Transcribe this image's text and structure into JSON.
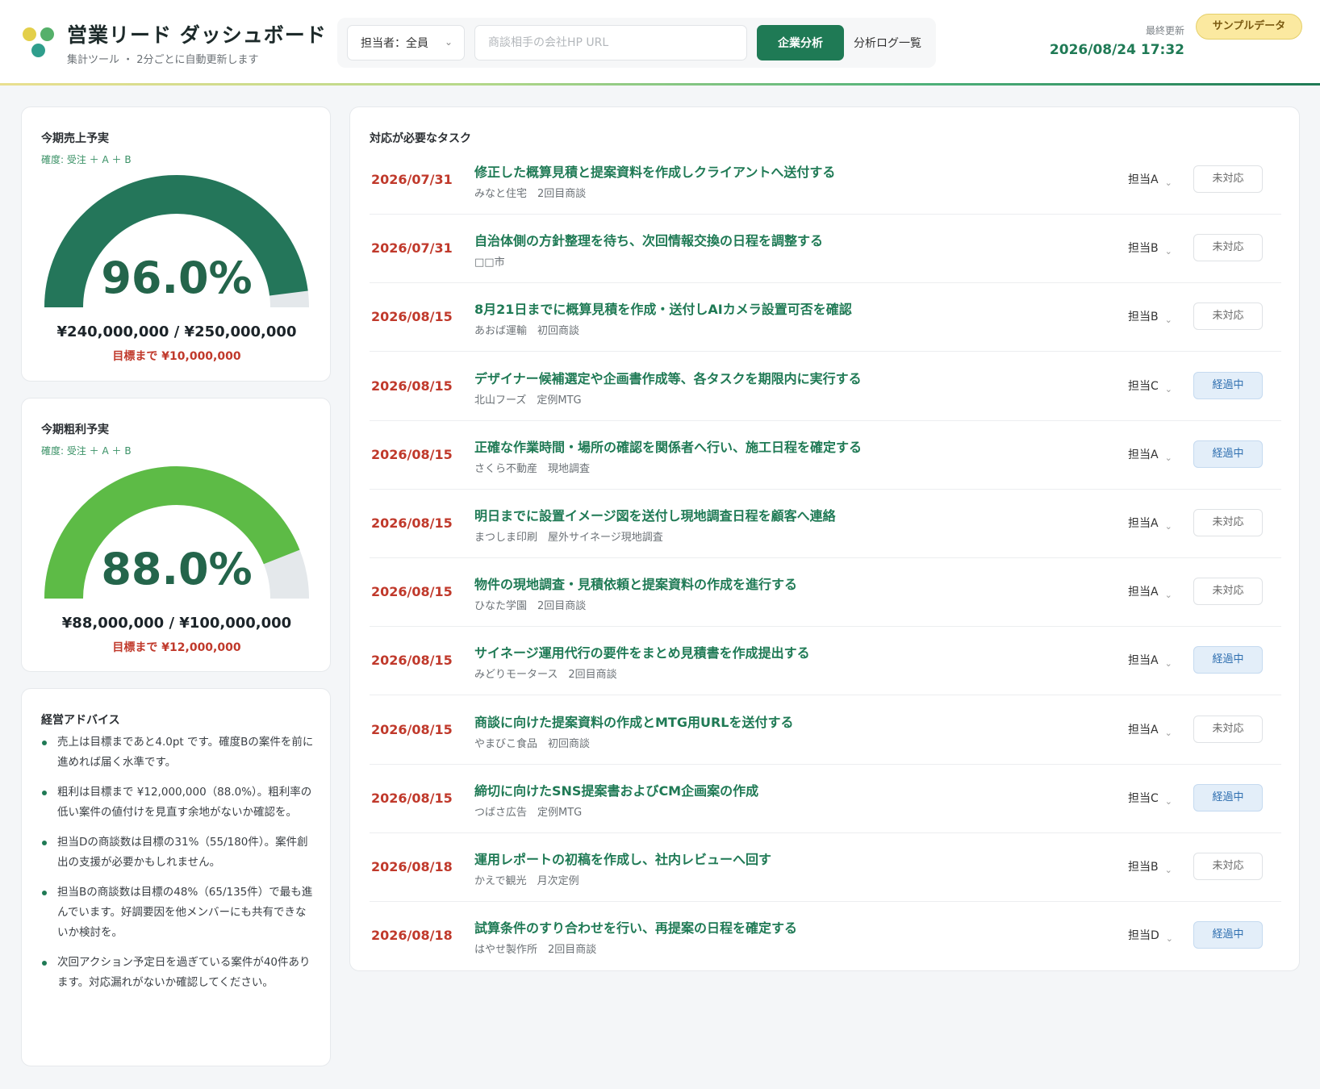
{
  "header": {
    "title": "営業リード ダッシュボード",
    "subtitle": "集計ツール ・ 2分ごとに自動更新します",
    "assignee_select": "担当者：全員",
    "url_placeholder": "商談相手の会社HP URL",
    "analyze_button": "企業分析",
    "log_link": "分析ログ一覧",
    "updated_label": "最終更新",
    "updated_value": "2026/08/24 17:32",
    "sample_badge": "サンプルデータ"
  },
  "colors": {
    "brand_green": "#1f7a55",
    "sales_gauge": "#24765a",
    "profit_gauge": "#5dbb46",
    "gauge_track": "#e4e8eb",
    "alert_red": "#c0392b",
    "overdue_blue": "#e3eef9"
  },
  "sales": {
    "title": "今期売上予実",
    "sub": "確度: 受注 ＋ A ＋ B",
    "percent": 96.0,
    "percent_label": "96.0%",
    "amount": "¥240,000,000 / ¥250,000,000",
    "remain": "目標まで ¥10,000,000"
  },
  "profit": {
    "title": "今期粗利予実",
    "sub": "確度: 受注 ＋ A ＋ B",
    "percent": 88.0,
    "percent_label": "88.0%",
    "amount": "¥88,000,000 / ¥100,000,000",
    "remain": "目標まで ¥12,000,000"
  },
  "advice": {
    "title": "経営アドバイス",
    "items": [
      "売上は目標まであと4.0pt です。確度Bの案件を前に進めれば届く水準です。",
      "粗利は目標まで ¥12,000,000（88.0%）。粗利率の低い案件の値付けを見直す余地がないか確認を。",
      "担当Dの商談数は目標の31%（55/180件）。案件創出の支援が必要かもしれません。",
      "担当Bの商談数は目標の48%（65/135件）で最も進んでいます。好調要因を他メンバーにも共有できないか検討を。",
      "次回アクション予定日を過ぎている案件が40件あります。対応漏れがないか確認してください。"
    ]
  },
  "tasks": {
    "title": "対応が必要なタスク",
    "rows": [
      {
        "date": "2026/07/31",
        "title": "修正した概算見積と提案資料を作成しクライアントへ送付する",
        "client": "みなと住宅　2回目商談",
        "assignee": "担当A",
        "status": "未対応",
        "status_type": "pending"
      },
      {
        "date": "2026/07/31",
        "title": "自治体側の方針整理を待ち、次回情報交換の日程を調整する",
        "client": "□□市",
        "assignee": "担当B",
        "status": "未対応",
        "status_type": "pending"
      },
      {
        "date": "2026/08/15",
        "title": "8月21日までに概算見積を作成・送付しAIカメラ設置可否を確認",
        "client": "あおば運輸　初回商談",
        "assignee": "担当B",
        "status": "未対応",
        "status_type": "pending"
      },
      {
        "date": "2026/08/15",
        "title": "デザイナー候補選定や企画書作成等、各タスクを期限内に実行する",
        "client": "北山フーズ　定例MTG",
        "assignee": "担当C",
        "status": "経過中",
        "status_type": "overdue"
      },
      {
        "date": "2026/08/15",
        "title": "正確な作業時間・場所の確認を関係者へ行い、施工日程を確定する",
        "client": "さくら不動産　現地調査",
        "assignee": "担当A",
        "status": "経過中",
        "status_type": "overdue"
      },
      {
        "date": "2026/08/15",
        "title": "明日までに設置イメージ図を送付し現地調査日程を顧客へ連絡",
        "client": "まつしま印刷　屋外サイネージ現地調査",
        "assignee": "担当A",
        "status": "未対応",
        "status_type": "pending"
      },
      {
        "date": "2026/08/15",
        "title": "物件の現地調査・見積依頼と提案資料の作成を進行する",
        "client": "ひなた学園　2回目商談",
        "assignee": "担当A",
        "status": "未対応",
        "status_type": "pending"
      },
      {
        "date": "2026/08/15",
        "title": "サイネージ運用代行の要件をまとめ見積書を作成提出する",
        "client": "みどりモータース　2回目商談",
        "assignee": "担当A",
        "status": "経過中",
        "status_type": "overdue"
      },
      {
        "date": "2026/08/15",
        "title": "商談に向けた提案資料の作成とMTG用URLを送付する",
        "client": "やまびこ食品　初回商談",
        "assignee": "担当A",
        "status": "未対応",
        "status_type": "pending"
      },
      {
        "date": "2026/08/15",
        "title": "締切に向けたSNS提案書およびCM企画案の作成",
        "client": "つばさ広告　定例MTG",
        "assignee": "担当C",
        "status": "経過中",
        "status_type": "overdue"
      },
      {
        "date": "2026/08/18",
        "title": "運用レポートの初稿を作成し、社内レビューへ回す",
        "client": "かえで観光　月次定例",
        "assignee": "担当B",
        "status": "未対応",
        "status_type": "pending"
      },
      {
        "date": "2026/08/18",
        "title": "試算条件のすり合わせを行い、再提案の日程を確定する",
        "client": "はやせ製作所　2回目商談",
        "assignee": "担当D",
        "status": "経過中",
        "status_type": "overdue"
      }
    ]
  }
}
